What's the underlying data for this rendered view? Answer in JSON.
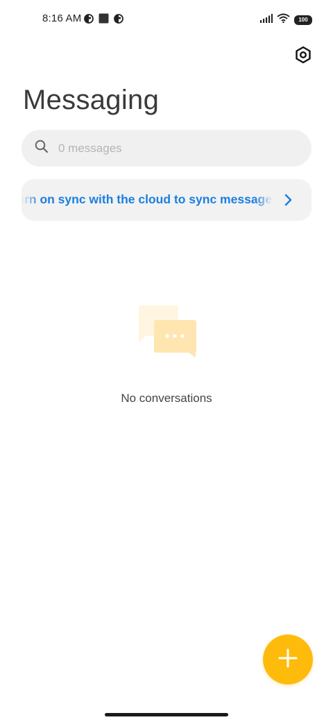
{
  "status_bar": {
    "time": "8:16 AM",
    "left_icons": [
      "data-saver-icon",
      "square-notification-icon",
      "data-saver-icon"
    ],
    "right_icons": [
      "signal-icon",
      "wifi-icon",
      "battery-icon"
    ],
    "battery_level": "100"
  },
  "header": {
    "title": "Messaging",
    "settings_icon": "settings-hexagon-icon"
  },
  "search": {
    "placeholder": "0 messages",
    "value": "",
    "icon": "search-icon"
  },
  "sync_banner": {
    "text": "Turn on sync with the cloud to sync messages",
    "icon": "chevron-right-icon",
    "color": "#1a7fe0"
  },
  "empty_state": {
    "icon": "chat-bubbles-icon",
    "text": "No conversations"
  },
  "fab": {
    "icon": "plus-icon",
    "color": "#ffbb0b"
  }
}
